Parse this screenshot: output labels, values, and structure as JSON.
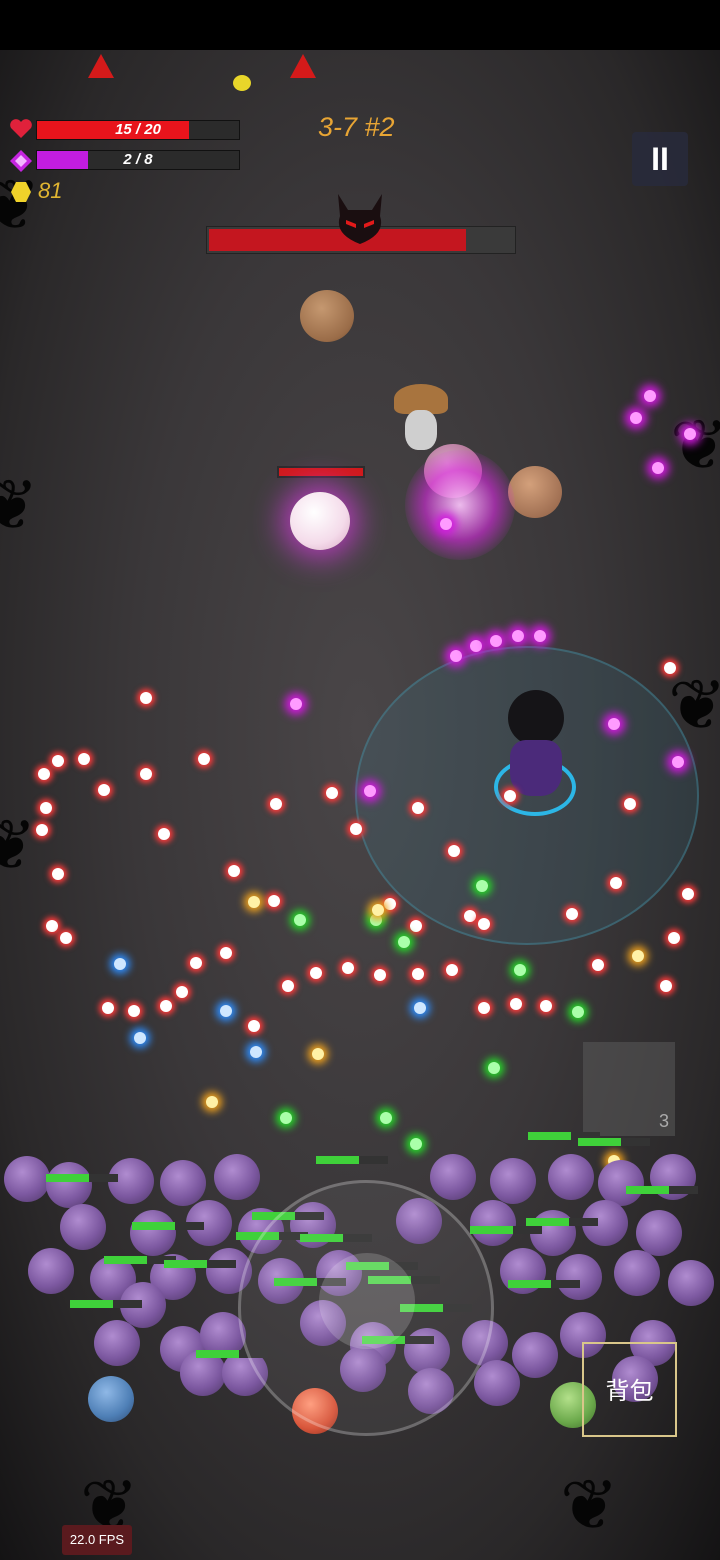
{
  "level": {
    "label": "3-7 #2"
  },
  "player": {
    "hp": {
      "text": "15 / 20",
      "value": 15,
      "max": 20,
      "color": "#e8141c"
    },
    "mana": {
      "text": "2 / 8",
      "value": 2,
      "max": 8,
      "color": "#c21de0"
    },
    "coins": "81"
  },
  "boss": {
    "health_fraction": 0.85,
    "bar_color": "#c4161f"
  },
  "mini_enemy_health_fraction": 1.0,
  "buttons": {
    "pause_icon": "pause-icon",
    "bag_label": "背包"
  },
  "skill_slot": {
    "count": "3"
  },
  "fps": "22.0 FPS",
  "icons": [
    "heart-icon",
    "mana-diamond-icon",
    "coin-icon",
    "demon-boss-icon",
    "warning-arrow-icon"
  ]
}
